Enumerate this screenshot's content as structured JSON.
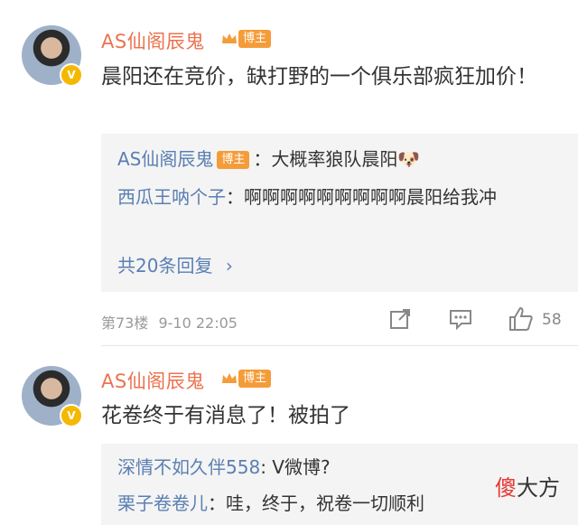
{
  "comments": [
    {
      "username": "AS仙阁辰鬼",
      "tag": "博主",
      "content": "晨阳还在竞价，缺打野的一个俱乐部疯狂加价！",
      "replies": [
        {
          "name": "AS仙阁辰鬼",
          "tag": "博主",
          "text": "：大概率狼队晨阳",
          "emoji": "🐶"
        },
        {
          "name": "西瓜王呐个子",
          "text": "：啊啊啊啊啊啊啊啊啊晨阳给我冲"
        }
      ],
      "more_replies": "共20条回复",
      "floor": "第73楼",
      "time": "9-10 22:05",
      "likes": "58"
    },
    {
      "username": "AS仙阁辰鬼",
      "tag": "博主",
      "content": "花卷终于有消息了！被拍了",
      "replies": [
        {
          "name": "深情不如久伴558",
          "text": ": V微博?"
        },
        {
          "name": "栗子卷卷儿",
          "text": "：哇，终于，祝卷一切顺利"
        }
      ]
    }
  ],
  "watermark": {
    "red": "傻",
    "rest": "大方"
  },
  "colors": {
    "username": "#eb7350",
    "link": "#5a7fb2",
    "tag": "#f59c3a"
  }
}
